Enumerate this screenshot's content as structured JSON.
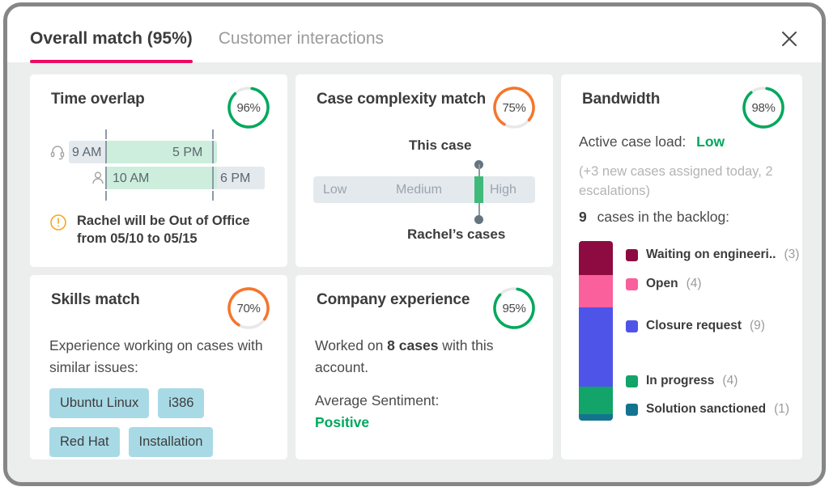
{
  "dialog": {
    "tabs": [
      {
        "label": "Overall match (95%)",
        "active": true
      },
      {
        "label": "Customer interactions",
        "active": false
      }
    ],
    "close_icon": "close-icon",
    "accent_color": "#ea0b63"
  },
  "cards": {
    "time_overlap": {
      "title": "Time overlap",
      "score": "96%",
      "score_color": "#00a85d",
      "rows": [
        {
          "icon": "headset-icon",
          "start": "9 AM",
          "end": "5 PM"
        },
        {
          "icon": "person-icon",
          "start": "10 AM",
          "end": "6 PM"
        }
      ],
      "notice": {
        "icon": "warning-icon",
        "text": "Rachel will be Out of Office from 05/10 to 05/15",
        "icon_color": "#f5a623"
      }
    },
    "case_complexity": {
      "title": "Case complexity match",
      "score": "75%",
      "score_color": "#f5762c",
      "top_label": "This case",
      "bottom_label": "Rachel’s cases",
      "segments": [
        "Low",
        "Medium",
        "High"
      ],
      "marker_color": "#3fba79",
      "marker_position_pct": 76
    },
    "bandwidth": {
      "title": "Bandwidth",
      "score": "98%",
      "score_color": "#00a85d",
      "active_case_load_label": "Active case load:",
      "active_case_load_value": "Low",
      "note": "(+3 new cases assigned today, 2 escalations)",
      "backlog_count": "9",
      "backlog_label": "cases in the backlog:",
      "backlog": [
        {
          "label": "Waiting on engineeri..",
          "count": "(3)",
          "value": 3,
          "color": "#8e0b42"
        },
        {
          "label": "Open",
          "count": "(4)",
          "value": 4,
          "color": "#f9609c"
        },
        {
          "label": "Closure request",
          "count": "(9)",
          "value": 9,
          "color": "#4f54e8"
        },
        {
          "label": "In progress",
          "count": "(4)",
          "value": 4,
          "color": "#12a468"
        },
        {
          "label": "Solution sanctioned",
          "count": "(1)",
          "value": 1,
          "color": "#14748f"
        }
      ]
    },
    "skills_match": {
      "title": "Skills match",
      "score": "70%",
      "score_color": "#f5762c",
      "description": "Experience working on cases with similar issues:",
      "chips": [
        "Ubuntu Linux",
        "i386",
        "Red Hat",
        "Installation"
      ],
      "chip_color": "#a8dae6"
    },
    "company_experience": {
      "title": "Company experience",
      "score": "95%",
      "score_color": "#00a85d",
      "line_prefix": "Worked on ",
      "line_strong": "8 cases",
      "line_suffix": " with this account.",
      "sentiment_label": "Average Sentiment:",
      "sentiment_value": "Positive",
      "sentiment_color": "#00a85d"
    }
  }
}
